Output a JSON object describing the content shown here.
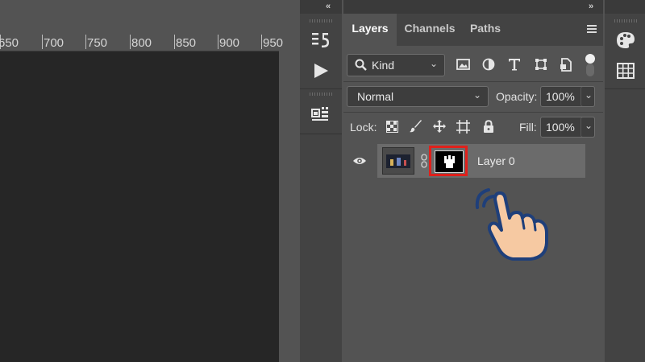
{
  "ruler": {
    "labels": [
      "650",
      "700",
      "750",
      "800",
      "850",
      "900",
      "950"
    ]
  },
  "panel_strip": {
    "collapse_left": "«",
    "collapse_right": "»",
    "history_icon": "history-icon",
    "actions_icon": "play-icon",
    "libraries_icon": "libraries-icon"
  },
  "layers_panel": {
    "tabs": [
      {
        "label": "Layers",
        "active": true
      },
      {
        "label": "Channels",
        "active": false
      },
      {
        "label": "Paths",
        "active": false
      }
    ],
    "filter": {
      "label": "Kind"
    },
    "blend_mode": "Normal",
    "opacity": {
      "label": "Opacity:",
      "value": "100%"
    },
    "lock": {
      "label": "Lock:"
    },
    "fill": {
      "label": "Fill:",
      "value": "100%"
    },
    "layers": [
      {
        "name": "Layer 0",
        "visible": true
      }
    ]
  },
  "colors": {
    "highlight_box": "#e0201b",
    "hand_fill": "#f6c9a2",
    "hand_outline": "#1f3f7a"
  }
}
